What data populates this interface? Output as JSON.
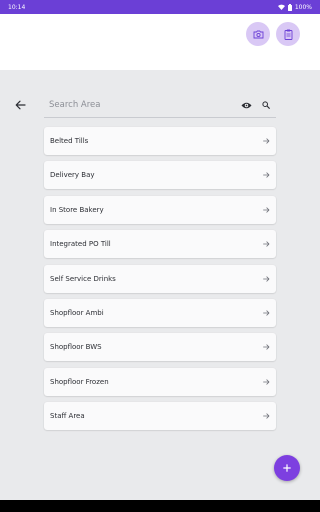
{
  "status_bar": {
    "time": "10:14",
    "battery": "100%"
  },
  "header": {
    "camera_icon": "camera-icon",
    "clipboard_icon": "clipboard-icon"
  },
  "search": {
    "placeholder": "Search Area",
    "value": ""
  },
  "areas": [
    {
      "label": "Belted Tills"
    },
    {
      "label": "Delivery Bay"
    },
    {
      "label": "In Store Bakery"
    },
    {
      "label": "Integrated PO Till"
    },
    {
      "label": "Self Service Drinks"
    },
    {
      "label": "Shopfloor Ambi"
    },
    {
      "label": "Shopfloor BWS"
    },
    {
      "label": "Shopfloor Frozen"
    },
    {
      "label": "Staff Area"
    }
  ],
  "colors": {
    "status_bar": "#6b3fd6",
    "fab": "#7d3fe0",
    "header_button": "#d9c8f5",
    "background": "#e9eaec"
  }
}
